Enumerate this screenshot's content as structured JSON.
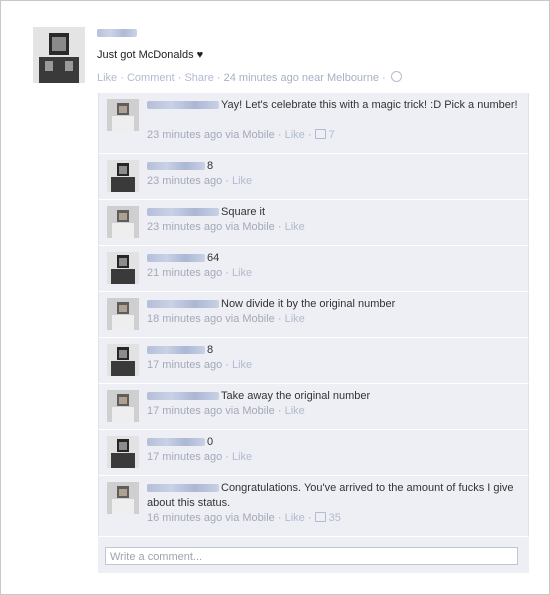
{
  "post": {
    "author_name": "Wolf Wang",
    "status_text": "Just got McDonalds ♥",
    "actions": {
      "like": "Like",
      "comment": "Comment",
      "share": "Share"
    },
    "separator": "·",
    "time_location": "24 minutes ago near Melbourne",
    "privacy_icon": "globe-icon"
  },
  "comments": [
    {
      "author": "Nathan Kenn",
      "text": "Yay! Let's celebrate this with a magic trick! :D Pick a number!",
      "time": "23 minutes ago via Mobile",
      "like": "Like",
      "likes": "7"
    },
    {
      "author": "Wolf Wang",
      "text": "8",
      "time": "23 minutes ago",
      "like": "Like",
      "likes": ""
    },
    {
      "author": "Nathan Kenn",
      "text": "Square it",
      "time": "23 minutes ago via Mobile",
      "like": "Like",
      "likes": ""
    },
    {
      "author": "Wolf Wang",
      "text": "64",
      "time": "21 minutes ago",
      "like": "Like",
      "likes": ""
    },
    {
      "author": "Nathan Kenn",
      "text": "Now divide it by the original number",
      "time": "18 minutes ago via Mobile",
      "like": "Like",
      "likes": ""
    },
    {
      "author": "Wolf Wang",
      "text": "8",
      "time": "17 minutes ago",
      "like": "Like",
      "likes": ""
    },
    {
      "author": "Nathan Kenn",
      "text": "Take away the original number",
      "time": "17 minutes ago via Mobile",
      "like": "Like",
      "likes": ""
    },
    {
      "author": "Wolf Wang",
      "text": "0",
      "time": "17 minutes ago",
      "like": "Like",
      "likes": ""
    },
    {
      "author": "Nathan Kenn",
      "text": "Congratulations. You've arrived to the amount of fucks I give about this status.",
      "time": "16 minutes ago via Mobile",
      "like": "Like",
      "likes": "35"
    }
  ],
  "composer": {
    "placeholder": "Write a comment..."
  },
  "colors": {
    "thread_bg": "#edeff4",
    "link": "#3b5998",
    "meta": "#a3a9b8"
  }
}
